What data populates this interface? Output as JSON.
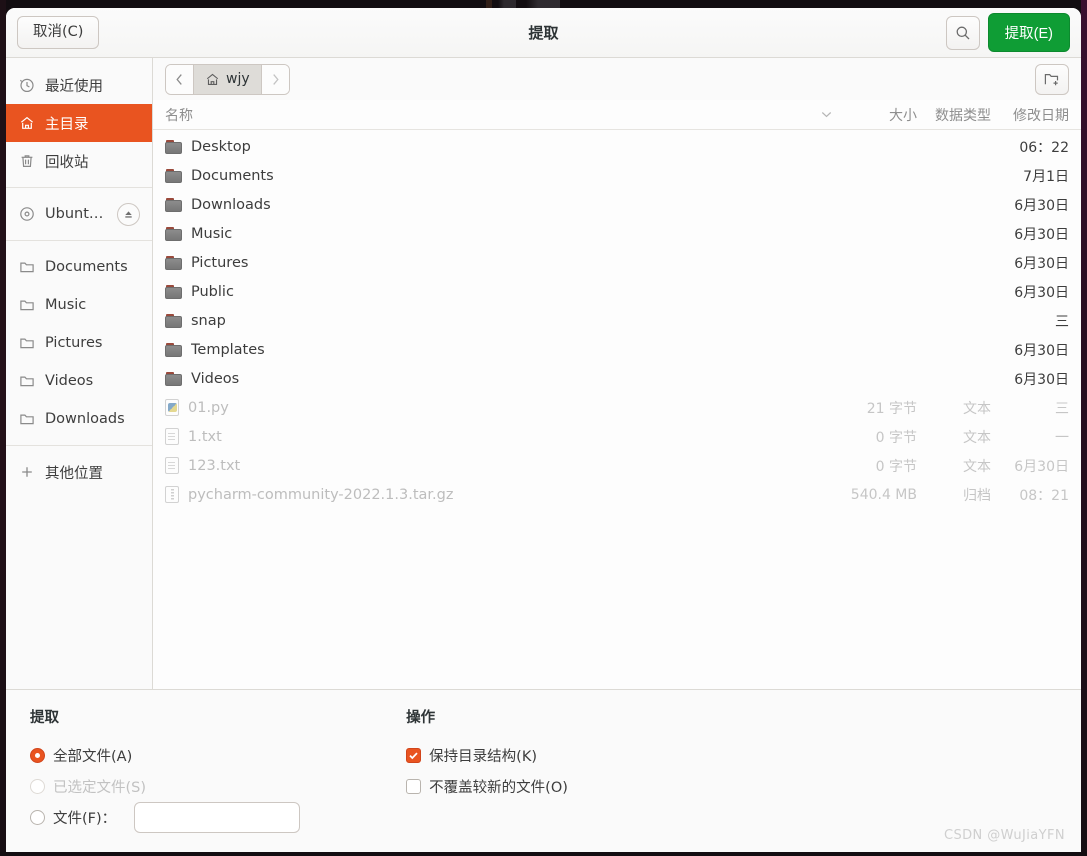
{
  "window": {
    "title": "提取",
    "cancel_label": "取消(C)",
    "extract_label": "提取(E)",
    "search_icon": "search-icon",
    "new_folder_icon": "new-folder-icon"
  },
  "sidebar": {
    "items": [
      {
        "label": "最近使用",
        "icon": "clock-icon",
        "active": false,
        "eject": false
      },
      {
        "label": "主目录",
        "icon": "home-icon",
        "active": true,
        "eject": false
      },
      {
        "label": "回收站",
        "icon": "trash-icon",
        "active": false,
        "eject": false
      },
      {
        "label": "Ubunt…",
        "icon": "disc-icon",
        "active": false,
        "eject": true
      },
      {
        "label": "Documents",
        "icon": "folder-icon",
        "active": false,
        "eject": false
      },
      {
        "label": "Music",
        "icon": "folder-icon",
        "active": false,
        "eject": false
      },
      {
        "label": "Pictures",
        "icon": "folder-icon",
        "active": false,
        "eject": false
      },
      {
        "label": "Videos",
        "icon": "folder-icon",
        "active": false,
        "eject": false
      },
      {
        "label": "Downloads",
        "icon": "folder-icon",
        "active": false,
        "eject": false
      },
      {
        "label": "其他位置",
        "icon": "plus-icon",
        "active": false,
        "eject": false
      }
    ]
  },
  "pathbar": {
    "back_icon": "chevron-left-icon",
    "forward_icon": "chevron-right-icon",
    "crumb_label": "wjy",
    "crumb_icon": "home-icon"
  },
  "columns": {
    "name": "名称",
    "size": "大小",
    "type": "数据类型",
    "date": "修改日期",
    "sort_icon": "chevron-down-icon"
  },
  "files": [
    {
      "name": "Desktop",
      "icon": "folder-icon",
      "size": "",
      "type": "",
      "date": "06：22",
      "dim": false
    },
    {
      "name": "Documents",
      "icon": "folder-icon",
      "size": "",
      "type": "",
      "date": "7月1日",
      "dim": false
    },
    {
      "name": "Downloads",
      "icon": "folder-icon",
      "size": "",
      "type": "",
      "date": "6月30日",
      "dim": false
    },
    {
      "name": "Music",
      "icon": "folder-icon",
      "size": "",
      "type": "",
      "date": "6月30日",
      "dim": false
    },
    {
      "name": "Pictures",
      "icon": "folder-icon",
      "size": "",
      "type": "",
      "date": "6月30日",
      "dim": false
    },
    {
      "name": "Public",
      "icon": "folder-icon",
      "size": "",
      "type": "",
      "date": "6月30日",
      "dim": false
    },
    {
      "name": "snap",
      "icon": "folder-icon",
      "size": "",
      "type": "",
      "date": "三",
      "dim": false
    },
    {
      "name": "Templates",
      "icon": "folder-icon",
      "size": "",
      "type": "",
      "date": "6月30日",
      "dim": false
    },
    {
      "name": "Videos",
      "icon": "folder-icon",
      "size": "",
      "type": "",
      "date": "6月30日",
      "dim": false
    },
    {
      "name": "01.py",
      "icon": "python-file-icon",
      "size": "21 字节",
      "type": "文本",
      "date": "三",
      "dim": true
    },
    {
      "name": "1.txt",
      "icon": "text-file-icon",
      "size": "0 字节",
      "type": "文本",
      "date": "一",
      "dim": true
    },
    {
      "name": "123.txt",
      "icon": "text-file-icon",
      "size": "0 字节",
      "type": "文本",
      "date": "6月30日",
      "dim": true
    },
    {
      "name": "pycharm-community-2022.1.3.tar.gz",
      "icon": "archive-file-icon",
      "size": "540.4 MB",
      "type": "归档",
      "date": "08：21",
      "dim": true
    }
  ],
  "options": {
    "extract": {
      "title": "提取",
      "rows": [
        {
          "label": "全部文件(A)",
          "checked": true,
          "disabled": false
        },
        {
          "label": "已选定文件(S)",
          "checked": false,
          "disabled": true
        },
        {
          "label": "文件(F)：",
          "checked": false,
          "disabled": false
        }
      ],
      "file_input_value": "",
      "file_input_placeholder": ""
    },
    "action": {
      "title": "操作",
      "rows": [
        {
          "label": "保持目录结构(K)",
          "checked": true,
          "disabled": false
        },
        {
          "label": "不覆盖较新的文件(O)",
          "checked": false,
          "disabled": false
        }
      ]
    }
  },
  "watermark": "CSDN @WuJiaYFN",
  "colors": {
    "accent": "#e95420",
    "extract_green": "#0f9d35",
    "header_bg": "#fafafa"
  }
}
